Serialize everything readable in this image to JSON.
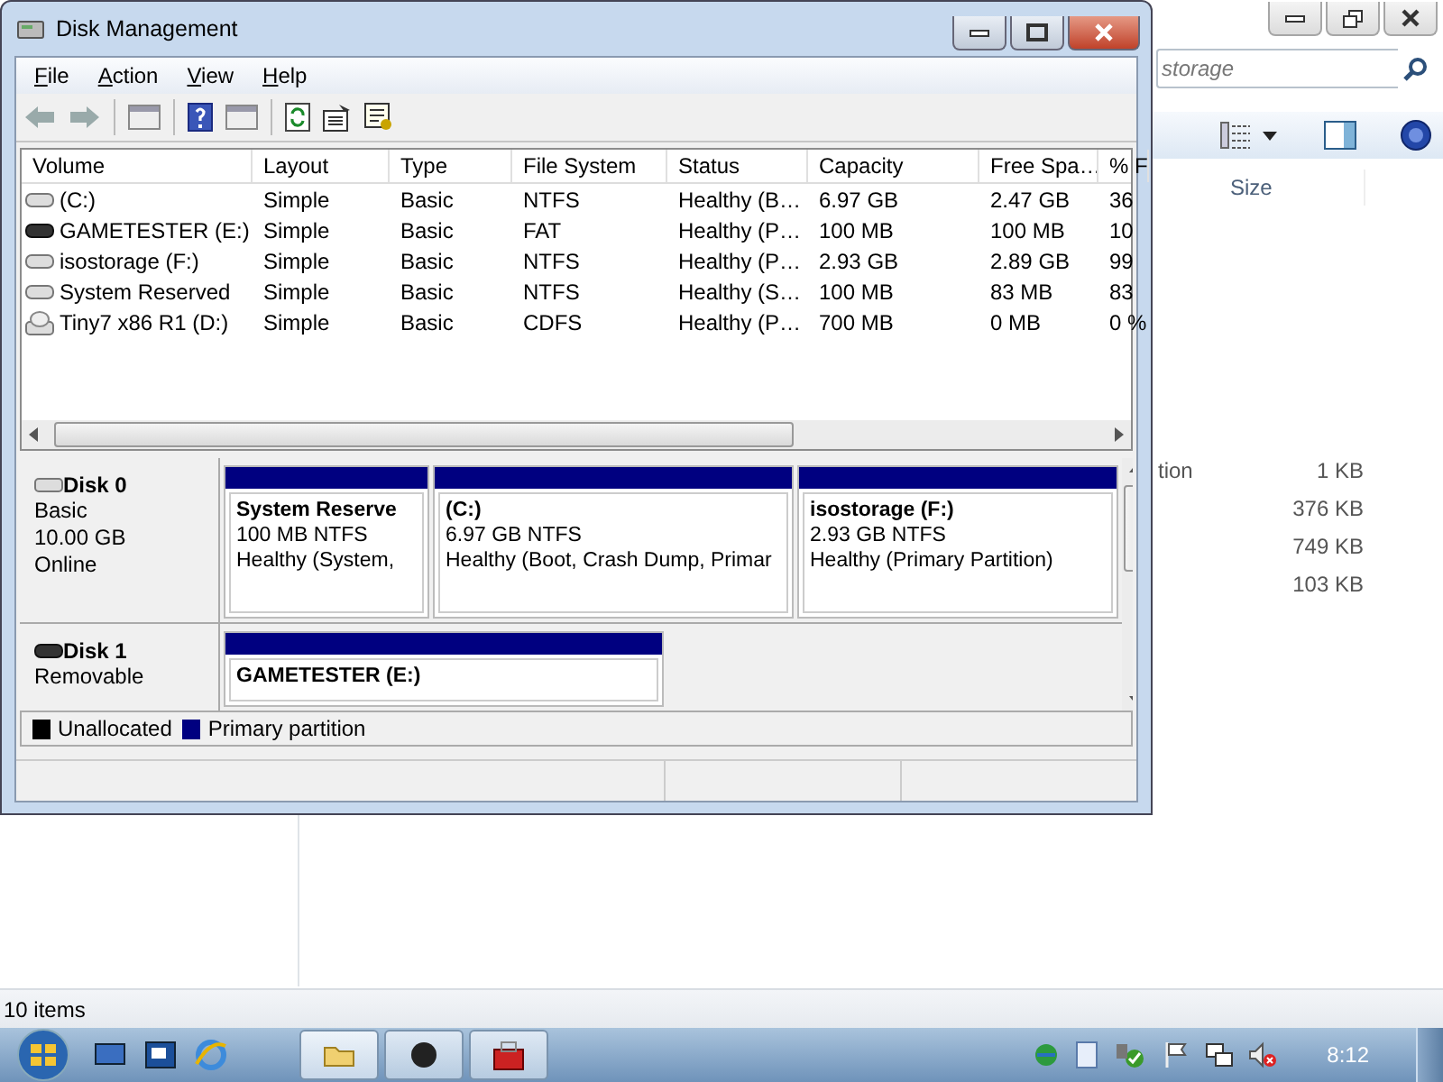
{
  "explorer": {
    "search": {
      "placeholder": "storage"
    },
    "columns": [
      "Size"
    ],
    "rows": [
      {
        "name": "tion",
        "size": "1 KB"
      },
      {
        "size": "376 KB"
      },
      {
        "size": "749 KB"
      },
      {
        "size": "103 KB"
      }
    ],
    "status": "10 items"
  },
  "window": {
    "title": "Disk Management"
  },
  "menu": [
    "File",
    "Action",
    "View",
    "Help"
  ],
  "volumes": {
    "columns": [
      "Volume",
      "Layout",
      "Type",
      "File System",
      "Status",
      "Capacity",
      "Free Spa…",
      "% F"
    ],
    "rows": [
      {
        "kind": "disk",
        "cells": [
          " (C:)",
          "Simple",
          "Basic",
          "NTFS",
          "Healthy (B…",
          "6.97 GB",
          "2.47 GB",
          "36"
        ]
      },
      {
        "kind": "removable",
        "cells": [
          "GAMETESTER (E:)",
          "Simple",
          "Basic",
          "FAT",
          "Healthy (P…",
          "100 MB",
          "100 MB",
          "10"
        ]
      },
      {
        "kind": "disk",
        "cells": [
          "isostorage (F:)",
          "Simple",
          "Basic",
          "NTFS",
          "Healthy (P…",
          "2.93 GB",
          "2.89 GB",
          "99"
        ]
      },
      {
        "kind": "disk",
        "cells": [
          "System Reserved",
          "Simple",
          "Basic",
          "NTFS",
          "Healthy (S…",
          "100 MB",
          "83 MB",
          "83"
        ]
      },
      {
        "kind": "cdrom",
        "cells": [
          "Tiny7 x86 R1 (D:)",
          "Simple",
          "Basic",
          "CDFS",
          "Healthy (P…",
          "700 MB",
          "0 MB",
          "0 %"
        ]
      }
    ]
  },
  "disks": [
    {
      "name": "Disk 0",
      "kind": "disk",
      "lines": [
        "Basic",
        "10.00 GB",
        "Online"
      ],
      "partitions": [
        {
          "name": "System Reserve",
          "size": "100 MB NTFS",
          "status": "Healthy (System,"
        },
        {
          "name": " (C:)",
          "size": "6.97 GB NTFS",
          "status": "Healthy (Boot, Crash Dump, Primar"
        },
        {
          "name": "isostorage  (F:)",
          "size": "2.93 GB NTFS",
          "status": "Healthy (Primary Partition)"
        }
      ]
    },
    {
      "name": "Disk 1",
      "kind": "removable",
      "lines": [
        "Removable"
      ],
      "partitions": [
        {
          "name": "GAMETESTER  (E:)"
        }
      ]
    }
  ],
  "legend": [
    {
      "label": "Unallocated",
      "color": "#000000"
    },
    {
      "label": "Primary partition",
      "color": "#000080"
    }
  ],
  "taskbar": {
    "clock": "8:12"
  }
}
